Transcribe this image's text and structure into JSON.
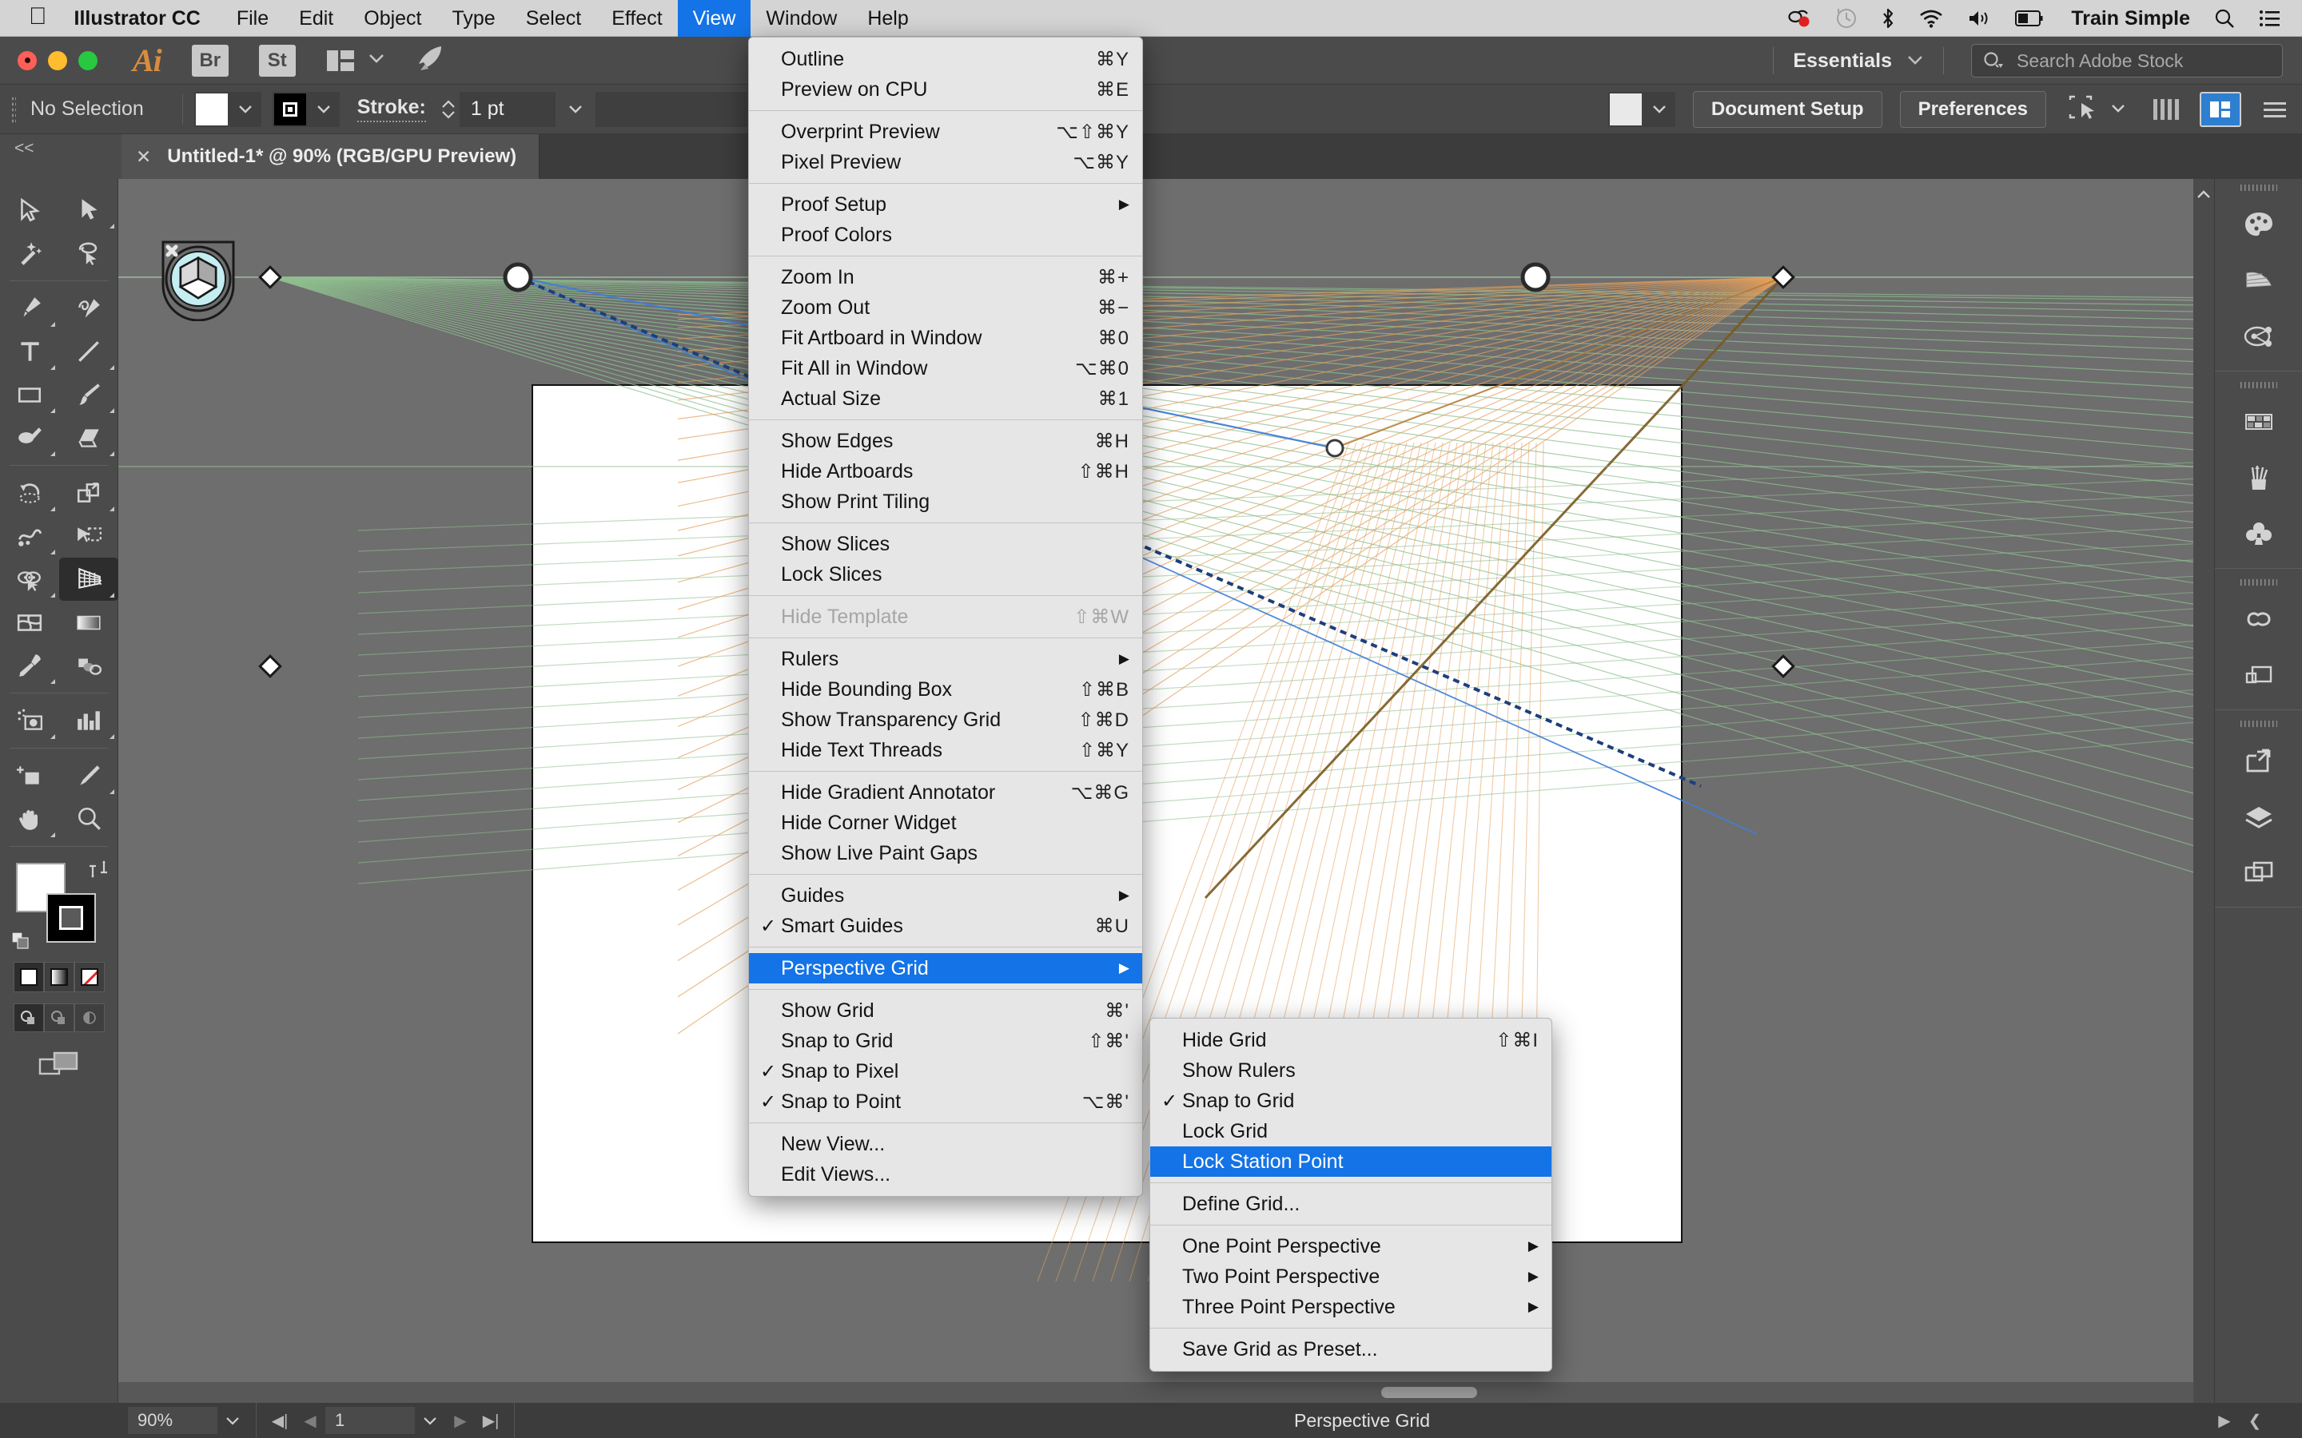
{
  "macbar": {
    "apple_icon": "apple-logo",
    "items": [
      {
        "label": "Illustrator CC",
        "bold": true,
        "active": false
      },
      {
        "label": "File",
        "active": false
      },
      {
        "label": "Edit",
        "active": false
      },
      {
        "label": "Object",
        "active": false
      },
      {
        "label": "Type",
        "active": false
      },
      {
        "label": "Select",
        "active": false
      },
      {
        "label": "Effect",
        "active": false
      },
      {
        "label": "View",
        "active": true
      },
      {
        "label": "Window",
        "active": false
      },
      {
        "label": "Help",
        "active": false
      }
    ],
    "status_icons": [
      "screen-record-icon",
      "time-machine-icon",
      "bluetooth-icon",
      "wifi-icon",
      "volume-icon",
      "battery-icon"
    ],
    "user": "Train Simple",
    "right_icons": [
      "spotlight-search-icon",
      "control-center-icon"
    ]
  },
  "appbar": {
    "app_badge": "Ai",
    "bridge_label": "Br",
    "stock_label": "St",
    "arrange_icon": "arrange-documents-icon",
    "chevron_icon": "chevron-down-icon",
    "rocket_icon": "rocket-icon",
    "workspace": "Essentials",
    "workspace_chevron": "chevron-down-icon",
    "search_placeholder": "Search Adobe Stock",
    "search_value": "",
    "search_icon": "search-icon"
  },
  "controlbar": {
    "selection_status": "No Selection",
    "fill_swatch": "#ffffff",
    "stroke_swatch": "#000000",
    "stroke_label": "Stroke:",
    "stroke_value": "1 pt",
    "stroke_profile": "",
    "opacity_swatch": "#e9e9e9",
    "document_setup_label": "Document Setup",
    "preferences_label": "Preferences",
    "align_icon": "align-to-selection-icon",
    "grid_icon": "grid-view-icon",
    "panel_menu_icon": "panel-menu-icon"
  },
  "tabbar": {
    "collapse_label": "<<",
    "document_title": "Untitled-1* @ 90% (RGB/GPU Preview)",
    "close_icon": "close-icon"
  },
  "toolbar": {
    "tools": [
      {
        "name": "selection-tool",
        "has_corner": false
      },
      {
        "name": "direct-selection-tool",
        "has_corner": true
      },
      {
        "name": "magic-wand-tool",
        "has_corner": false
      },
      {
        "name": "lasso-tool",
        "has_corner": false
      },
      {
        "name": "pen-tool",
        "has_corner": true
      },
      {
        "name": "curvature-tool",
        "has_corner": false
      },
      {
        "name": "type-tool",
        "has_corner": true
      },
      {
        "name": "line-segment-tool",
        "has_corner": true
      },
      {
        "name": "rectangle-tool",
        "has_corner": true
      },
      {
        "name": "paintbrush-tool",
        "has_corner": true
      },
      {
        "name": "shaper-tool",
        "has_corner": true
      },
      {
        "name": "eraser-tool",
        "has_corner": true
      },
      {
        "name": "rotate-tool",
        "has_corner": true
      },
      {
        "name": "scale-tool",
        "has_corner": true
      },
      {
        "name": "width-tool",
        "has_corner": true
      },
      {
        "name": "free-transform-tool",
        "has_corner": false
      },
      {
        "name": "shape-builder-tool",
        "has_corner": true
      },
      {
        "name": "perspective-grid-tool",
        "has_corner": true,
        "active": true
      },
      {
        "name": "mesh-tool",
        "has_corner": false
      },
      {
        "name": "gradient-tool",
        "has_corner": false
      },
      {
        "name": "eyedropper-tool",
        "has_corner": true
      },
      {
        "name": "blend-tool",
        "has_corner": false
      },
      {
        "name": "symbol-sprayer-tool",
        "has_corner": true
      },
      {
        "name": "column-graph-tool",
        "has_corner": true
      },
      {
        "name": "artboard-tool",
        "has_corner": false
      },
      {
        "name": "slice-tool",
        "has_corner": true
      },
      {
        "name": "hand-tool",
        "has_corner": true
      },
      {
        "name": "zoom-tool",
        "has_corner": false
      }
    ],
    "fill_color": "#ffffff",
    "stroke_color": "#000000",
    "swap_icon": "swap-fill-stroke-icon",
    "default_icon": "default-fill-stroke-icon",
    "paint_modes": [
      "color-mode-icon",
      "gradient-mode-icon",
      "none-mode-icon"
    ],
    "draw_modes": [
      "draw-normal-icon",
      "draw-behind-icon",
      "draw-inside-icon"
    ],
    "screen_mode_icon": "change-screen-mode-icon"
  },
  "right_dock": {
    "collapse_icon": "expand-panels-icon",
    "groups": [
      {
        "icons": [
          "color-panel-icon",
          "color-guide-panel-icon",
          "edit-colors-panel-icon"
        ]
      },
      {
        "icons": [
          "swatches-panel-icon",
          "brushes-panel-icon",
          "symbols-panel-icon"
        ]
      },
      {
        "icons": [
          "libraries-panel-icon",
          "artboards-panel-icon"
        ]
      },
      {
        "icons": [
          "export-panel-icon",
          "layers-panel-icon",
          "links-panel-icon"
        ]
      }
    ]
  },
  "canvas": {
    "artboard_background": "#ffffff",
    "canvas_background": "#6e6e6e",
    "perspective_widget_icon": "perspective-grid-widget-icon",
    "perspective_widget_close_icon": "close-icon",
    "grid_colors": {
      "left_plane": "#8fbf8f",
      "right_plane": "#e5a05c",
      "horizon": "#9bbf9b",
      "active_plane_highlight": "#2f6fd0"
    }
  },
  "statusbar": {
    "zoom_level": "90%",
    "zoom_chevron_icon": "chevron-down-icon",
    "first_page_icon": "first-artboard-icon",
    "prev_page_icon": "previous-artboard-icon",
    "page_number": "1",
    "page_chevron_icon": "chevron-down-icon",
    "next_page_icon": "next-artboard-icon",
    "last_page_icon": "last-artboard-icon",
    "status_text": "Perspective Grid",
    "status_menu_icon": "status-menu-icon",
    "resize_icon": "resize-grip-icon"
  },
  "view_menu": {
    "sections": [
      {
        "items": [
          {
            "label": "Outline",
            "key": "⌘Y"
          },
          {
            "label": "Preview on CPU",
            "key": "⌘E"
          }
        ]
      },
      {
        "items": [
          {
            "label": "Overprint Preview",
            "key": "⌥⇧⌘Y"
          },
          {
            "label": "Pixel Preview",
            "key": "⌥⌘Y"
          }
        ]
      },
      {
        "items": [
          {
            "label": "Proof Setup",
            "key": "",
            "submenu": true
          },
          {
            "label": "Proof Colors",
            "key": ""
          }
        ]
      },
      {
        "items": [
          {
            "label": "Zoom In",
            "key": "⌘+"
          },
          {
            "label": "Zoom Out",
            "key": "⌘−"
          },
          {
            "label": "Fit Artboard in Window",
            "key": "⌘0"
          },
          {
            "label": "Fit All in Window",
            "key": "⌥⌘0"
          },
          {
            "label": "Actual Size",
            "key": "⌘1"
          }
        ]
      },
      {
        "items": [
          {
            "label": "Show Edges",
            "key": "⌘H"
          },
          {
            "label": "Hide Artboards",
            "key": "⇧⌘H"
          },
          {
            "label": "Show Print Tiling",
            "key": ""
          }
        ]
      },
      {
        "items": [
          {
            "label": "Show Slices",
            "key": ""
          },
          {
            "label": "Lock Slices",
            "key": ""
          }
        ]
      },
      {
        "items": [
          {
            "label": "Hide Template",
            "key": "⇧⌘W",
            "disabled": true
          }
        ]
      },
      {
        "items": [
          {
            "label": "Rulers",
            "key": "",
            "submenu": true
          },
          {
            "label": "Hide Bounding Box",
            "key": "⇧⌘B"
          },
          {
            "label": "Show Transparency Grid",
            "key": "⇧⌘D"
          },
          {
            "label": "Hide Text Threads",
            "key": "⇧⌘Y"
          }
        ]
      },
      {
        "items": [
          {
            "label": "Hide Gradient Annotator",
            "key": "⌥⌘G"
          },
          {
            "label": "Hide Corner Widget",
            "key": ""
          },
          {
            "label": "Show Live Paint Gaps",
            "key": ""
          }
        ]
      },
      {
        "items": [
          {
            "label": "Guides",
            "key": "",
            "submenu": true
          },
          {
            "label": "Smart Guides",
            "key": "⌘U",
            "checked": true
          }
        ]
      },
      {
        "items": [
          {
            "label": "Perspective Grid",
            "key": "",
            "submenu": true,
            "highlighted": true
          }
        ]
      },
      {
        "items": [
          {
            "label": "Show Grid",
            "key": "⌘'"
          },
          {
            "label": "Snap to Grid",
            "key": "⇧⌘'"
          },
          {
            "label": "Snap to Pixel",
            "key": "",
            "checked": true
          },
          {
            "label": "Snap to Point",
            "key": "⌥⌘'",
            "checked": true
          }
        ]
      },
      {
        "items": [
          {
            "label": "New View...",
            "key": ""
          },
          {
            "label": "Edit Views...",
            "key": ""
          }
        ]
      }
    ]
  },
  "perspective_submenu": {
    "sections": [
      {
        "items": [
          {
            "label": "Hide Grid",
            "key": "⇧⌘I"
          },
          {
            "label": "Show Rulers",
            "key": ""
          },
          {
            "label": "Snap to Grid",
            "key": "",
            "checked": true
          },
          {
            "label": "Lock Grid",
            "key": ""
          },
          {
            "label": "Lock Station Point",
            "key": "",
            "highlighted": true
          }
        ]
      },
      {
        "items": [
          {
            "label": "Define Grid...",
            "key": ""
          }
        ]
      },
      {
        "items": [
          {
            "label": "One Point Perspective",
            "key": "",
            "submenu": true
          },
          {
            "label": "Two Point Perspective",
            "key": "",
            "submenu": true
          },
          {
            "label": "Three Point Perspective",
            "key": "",
            "submenu": true
          }
        ]
      },
      {
        "items": [
          {
            "label": "Save Grid as Preset...",
            "key": ""
          }
        ]
      }
    ]
  }
}
